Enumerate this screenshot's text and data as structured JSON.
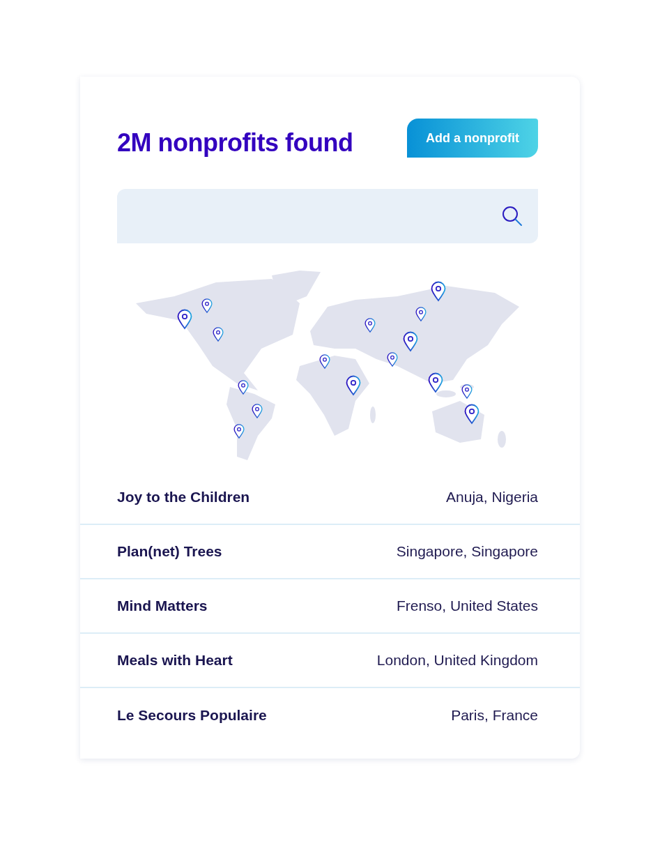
{
  "header": {
    "title": "2M nonprofits found",
    "button": "Add a nonprofit"
  },
  "nonprofits": [
    {
      "name": "Joy to the Children",
      "location": "Anuja, Nigeria"
    },
    {
      "name": "Plan(net) Trees",
      "location": "Singapore, Singapore"
    },
    {
      "name": "Mind Matters",
      "location": "Frenso, United States"
    },
    {
      "name": "Meals with Heart",
      "location": "London, United Kingdom"
    },
    {
      "name": "Le Secours Populaire",
      "location": "Paris, France"
    }
  ]
}
